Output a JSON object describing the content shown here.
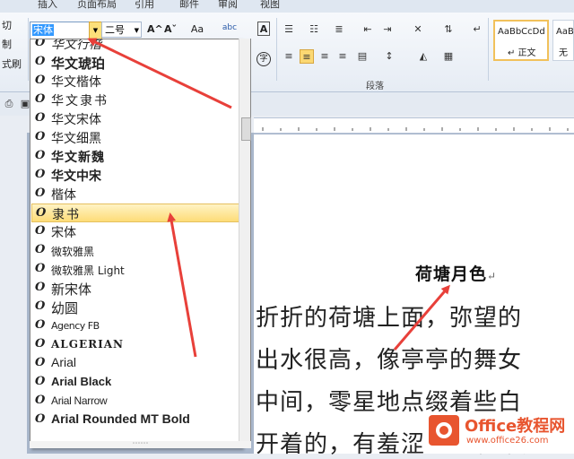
{
  "ribbon_tabs": [
    "插入",
    "页面布局",
    "引用",
    "邮件",
    "审阅",
    "视图"
  ],
  "left_strip": [
    "切",
    "制",
    "式刷"
  ],
  "font": {
    "current": "宋体",
    "size": "二号",
    "grow_icon": "A^",
    "shrink_icon": "Aˇ",
    "case_icon": "Aa",
    "clear_icon": "abc",
    "border_letter": "A",
    "circle_char": "字"
  },
  "paragraph_group_label": "段落",
  "styles": {
    "normal_preview": "AaBbCcDd",
    "normal_label": "↵ 正文",
    "next_preview": "AaBl",
    "next_label": "无"
  },
  "font_list": [
    "华文行楷",
    "华文琥珀",
    "华文楷体",
    "华文隶书",
    "华文宋体",
    "华文细黑",
    "华文新魏",
    "华文中宋",
    "楷体",
    "隶书",
    "宋体",
    "微软雅黑",
    "微软雅黑 Light",
    "新宋体",
    "幼圆",
    "Agency FB",
    "ALGERIAN",
    "Arial",
    "Arial Black",
    "Arial Narrow",
    "Arial Rounded MT Bold"
  ],
  "font_list_selected": "隶书",
  "document": {
    "title": "荷塘月色",
    "lines": [
      "折折的荷塘上面，弥望的",
      "出水很高，像亭亭的舞女",
      "中间，零星地点缀着些白",
      "开着的，有羞涩的打着朵儿的"
    ]
  },
  "watermark": {
    "title": "Office教程网",
    "url": "www.office26.com"
  },
  "colors": {
    "arrow": "#e8403a",
    "highlight": "#fddc77",
    "selection": "#3399ff"
  }
}
